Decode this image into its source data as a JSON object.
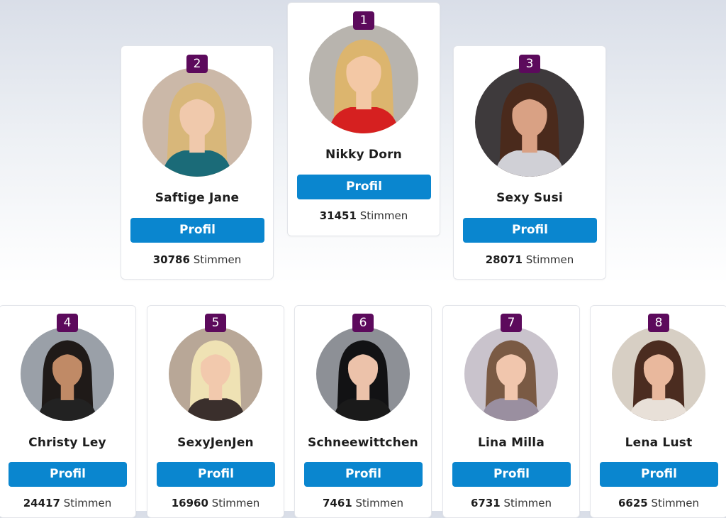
{
  "votes_suffix": "Stimmen",
  "profile_label": "Profil",
  "top": [
    {
      "rank": "2",
      "name": "Saftige Jane",
      "votes": "30786",
      "avatar": {
        "bg": "#cbb8a8",
        "hair": "#d8b77a",
        "skin": "#f0c9ac",
        "top": "#1b6b78"
      }
    },
    {
      "rank": "1",
      "name": "Nikky Dorn",
      "votes": "31451",
      "avatar": {
        "bg": "#b8b4ae",
        "hair": "#dcb56e",
        "skin": "#f3c8a5",
        "top": "#d62020"
      }
    },
    {
      "rank": "3",
      "name": "Sexy Susi",
      "votes": "28071",
      "avatar": {
        "bg": "#3e3a3c",
        "hair": "#4a2a1c",
        "skin": "#d9a184",
        "top": "#d0d0d6"
      }
    }
  ],
  "rest": [
    {
      "rank": "4",
      "name": "Christy Ley",
      "votes": "24417",
      "avatar": {
        "bg": "#9aa0a8",
        "hair": "#1f1a18",
        "skin": "#c08a66",
        "top": "#222222"
      }
    },
    {
      "rank": "5",
      "name": "SexyJenJen",
      "votes": "16960",
      "avatar": {
        "bg": "#b8a797",
        "hair": "#efe2b4",
        "skin": "#f2c9ad",
        "top": "#3a2f2c"
      }
    },
    {
      "rank": "6",
      "name": "Schneewittchen",
      "votes": "7461",
      "avatar": {
        "bg": "#8d9096",
        "hair": "#121214",
        "skin": "#ecc2aa",
        "top": "#1a1a1a"
      }
    },
    {
      "rank": "7",
      "name": "Lina Milla",
      "votes": "6731",
      "avatar": {
        "bg": "#c9c3cc",
        "hair": "#7a5a44",
        "skin": "#f1c6ad",
        "top": "#9a8fa0"
      }
    },
    {
      "rank": "8",
      "name": "Lena Lust",
      "votes": "6625",
      "avatar": {
        "bg": "#d7cfc4",
        "hair": "#4b2c20",
        "skin": "#e9b89d",
        "top": "#e8e0d8"
      }
    }
  ]
}
